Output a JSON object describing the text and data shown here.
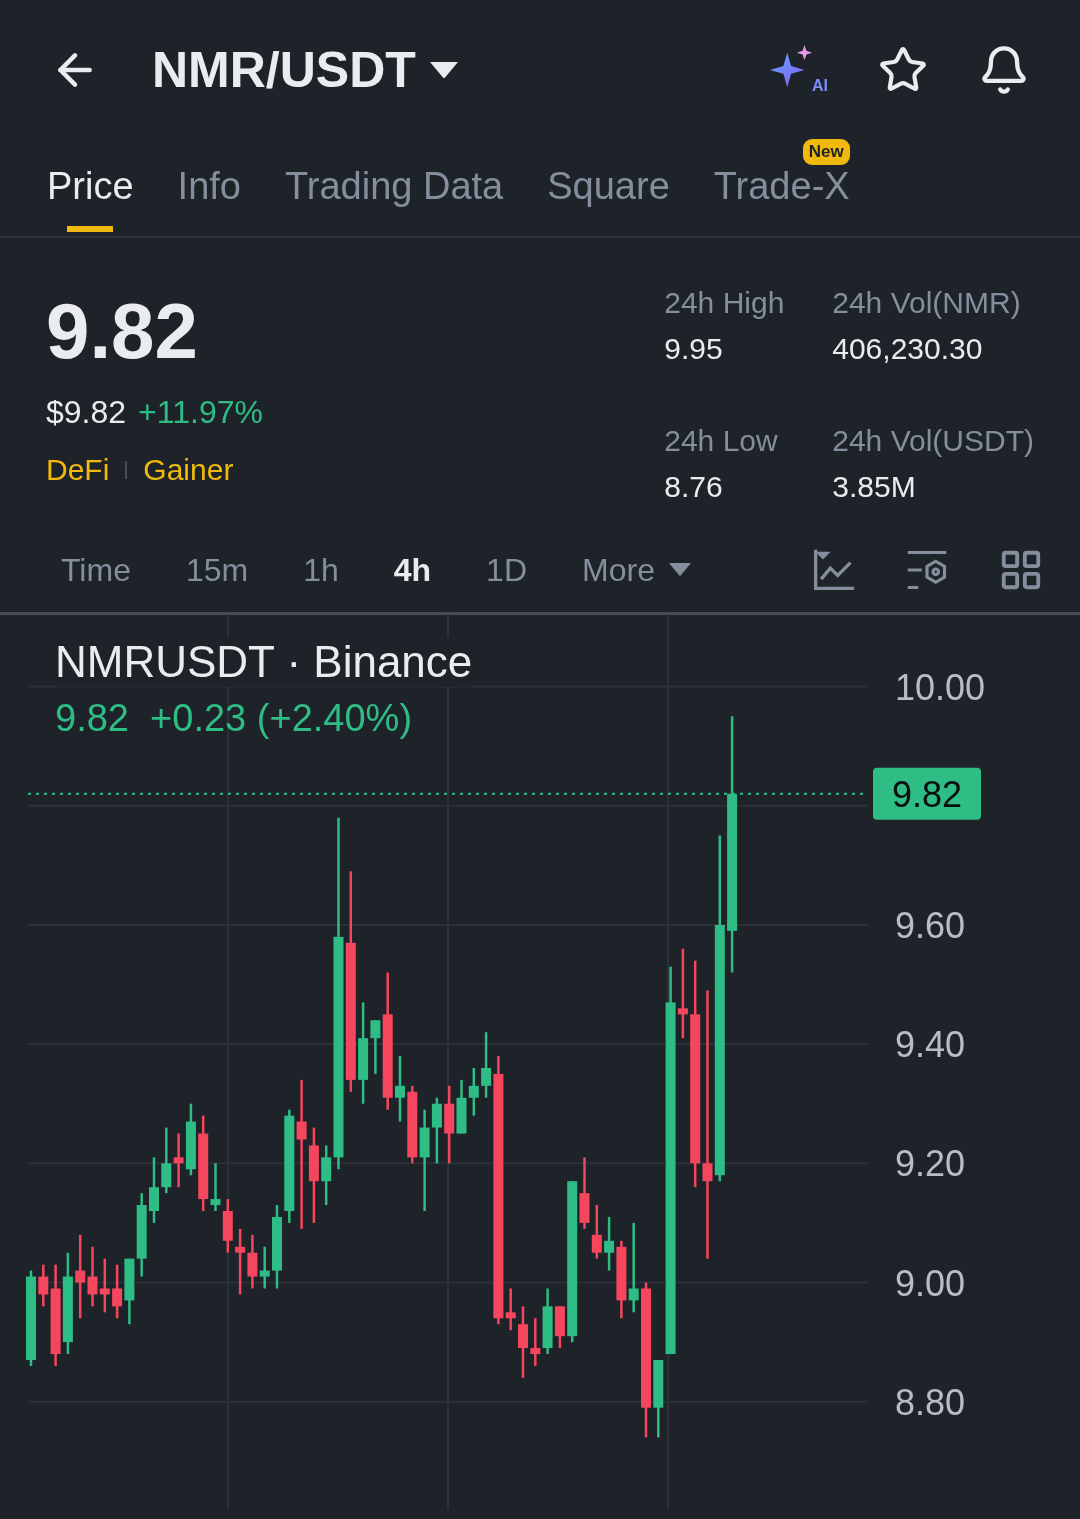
{
  "header": {
    "pair": "NMR/USDT",
    "ai_label": "AI"
  },
  "tabs": [
    {
      "label": "Price",
      "selected": true
    },
    {
      "label": "Info",
      "selected": false
    },
    {
      "label": "Trading Data",
      "selected": false
    },
    {
      "label": "Square",
      "selected": false
    },
    {
      "label": "Trade-X",
      "selected": false,
      "badge": "New"
    }
  ],
  "price": {
    "last": "9.82",
    "usd": "$9.82",
    "change": "+11.97%",
    "tags": [
      "DeFi",
      "Gainer"
    ]
  },
  "stats": [
    {
      "label": "24h High",
      "value": "9.95"
    },
    {
      "label": "24h Vol(NMR)",
      "value": "406,230.30"
    },
    {
      "label": "24h Low",
      "value": "8.76"
    },
    {
      "label": "24h Vol(USDT)",
      "value": "3.85M"
    }
  ],
  "intervals": [
    {
      "label": "Time",
      "selected": false
    },
    {
      "label": "15m",
      "selected": false
    },
    {
      "label": "1h",
      "selected": false
    },
    {
      "label": "4h",
      "selected": true
    },
    {
      "label": "1D",
      "selected": false
    },
    {
      "label": "More",
      "selected": false,
      "dropdown": true
    }
  ],
  "chart": {
    "title": "NMRUSDT · Binance",
    "quote": "9.82  +0.23 (+2.40%)",
    "last_price_tag": "9.82",
    "price_axis": [
      "10.00",
      "9.60",
      "9.40",
      "9.20",
      "9.00",
      "8.80"
    ]
  }
}
